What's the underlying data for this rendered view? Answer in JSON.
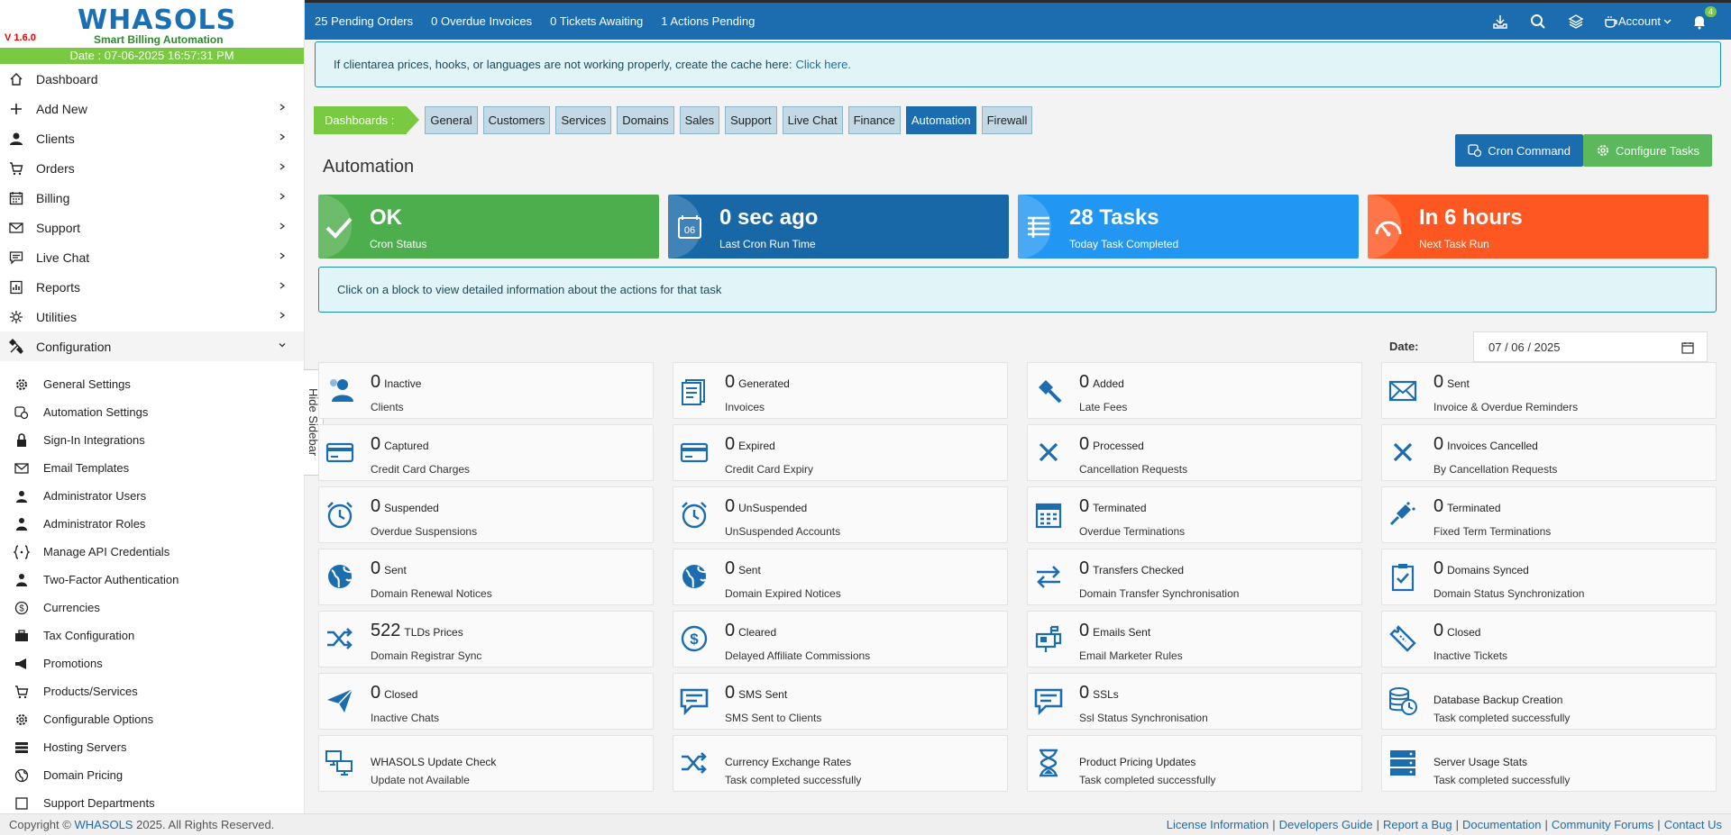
{
  "app": {
    "version": "V 1.6.0",
    "brand": "WHASOLS",
    "tagline": "Smart Billing Automation",
    "datetime": "Date : 07-06-2025 16:57:31 PM",
    "hide_sidebar": "Hide Sidebar"
  },
  "sidebar": {
    "items": [
      {
        "label": "Dashboard",
        "icon": "home-icon"
      },
      {
        "label": "Add New",
        "icon": "plus-icon"
      },
      {
        "label": "Clients",
        "icon": "user-icon"
      },
      {
        "label": "Orders",
        "icon": "cart-icon"
      },
      {
        "label": "Billing",
        "icon": "calendar-icon"
      },
      {
        "label": "Support",
        "icon": "envelope-icon"
      },
      {
        "label": "Live Chat",
        "icon": "chat-icon"
      },
      {
        "label": "Reports",
        "icon": "report-icon"
      },
      {
        "label": "Utilities",
        "icon": "utilities-icon"
      },
      {
        "label": "Configuration",
        "icon": "tools-icon"
      }
    ],
    "submenu": [
      "General Settings",
      "Automation Settings",
      "Sign-In Integrations",
      "Email Templates",
      "Administrator Users",
      "Administrator Roles",
      "Manage API Credentials",
      "Two-Factor Authentication",
      "Currencies",
      "Tax Configuration",
      "Promotions",
      "Products/Services",
      "Configurable Options",
      "Hosting Servers",
      "Domain Pricing",
      "Support Departments"
    ]
  },
  "topbar": {
    "pending_orders": "25 Pending Orders",
    "overdue_invoices": "0 Overdue Invoices",
    "tickets_awaiting": "0 Tickets Awaiting",
    "actions_pending": "1 Actions Pending",
    "account": "Account",
    "notification_count": "4"
  },
  "notice": {
    "text": "If clientarea prices, hooks, or languages are not working properly, create the cache here:",
    "link": "Click here."
  },
  "dashboards": {
    "label": "Dashboards :",
    "tabs": [
      "General",
      "Customers",
      "Services",
      "Domains",
      "Sales",
      "Support",
      "Live Chat",
      "Finance",
      "Automation",
      "Firewall"
    ],
    "active": "Automation"
  },
  "page": {
    "title": "Automation",
    "cron_command": "Cron Command",
    "configure_tasks": "Configure Tasks",
    "info": "Click on a block to view detailed information about the actions for that task",
    "date_label": "Date:",
    "date_value": "07 / 06 / 2025"
  },
  "stats": [
    {
      "value": "OK",
      "label": "Cron Status",
      "color": "#4cae4c"
    },
    {
      "value": "0 sec ago",
      "label": "Last Cron Run Time",
      "color": "#1868a8"
    },
    {
      "value": "28 Tasks",
      "label": "Today Task Completed",
      "color": "#2196f3"
    },
    {
      "value": "In 6 hours",
      "label": "Next Task Run",
      "color": "#fe5722"
    }
  ],
  "tasks": [
    {
      "num": "0",
      "unit": "Inactive",
      "sub": "Clients",
      "icon": "clients-icon"
    },
    {
      "num": "0",
      "unit": "Generated",
      "sub": "Invoices",
      "icon": "invoices-icon"
    },
    {
      "num": "0",
      "unit": "Added",
      "sub": "Late Fees",
      "icon": "gavel-icon"
    },
    {
      "num": "0",
      "unit": "Sent",
      "sub": "Invoice & Overdue Reminders",
      "icon": "envelope-icon"
    },
    {
      "num": "0",
      "unit": "Captured",
      "sub": "Credit Card Charges",
      "icon": "credit-card-icon"
    },
    {
      "num": "0",
      "unit": "Expired",
      "sub": "Credit Card Expiry",
      "icon": "credit-card-icon"
    },
    {
      "num": "0",
      "unit": "Processed",
      "sub": "Cancellation Requests",
      "icon": "close-icon"
    },
    {
      "num": "0",
      "unit": "Invoices Cancelled",
      "sub": "By Cancellation Requests",
      "icon": "close-icon"
    },
    {
      "num": "0",
      "unit": "Suspended",
      "sub": "Overdue Suspensions",
      "icon": "alarm-clock-icon"
    },
    {
      "num": "0",
      "unit": "UnSuspended",
      "sub": "UnSuspended Accounts",
      "icon": "alarm-clock-icon"
    },
    {
      "num": "0",
      "unit": "Terminated",
      "sub": "Overdue Terminations",
      "icon": "calendar-icon"
    },
    {
      "num": "0",
      "unit": "Terminated",
      "sub": "Fixed Term Terminations",
      "icon": "plug-icon"
    },
    {
      "num": "0",
      "unit": "Sent",
      "sub": "Domain Renewal Notices",
      "icon": "globe-icon"
    },
    {
      "num": "0",
      "unit": "Sent",
      "sub": "Domain Expired Notices",
      "icon": "globe-icon"
    },
    {
      "num": "0",
      "unit": "Transfers Checked",
      "sub": "Domain Transfer Synchronisation",
      "icon": "transfer-icon"
    },
    {
      "num": "0",
      "unit": "Domains Synced",
      "sub": "Domain Status Synchronization",
      "icon": "clipboard-check-icon"
    },
    {
      "num": "522",
      "unit": "TLDs Prices",
      "sub": "Domain Registrar Sync",
      "icon": "shuffle-icon"
    },
    {
      "num": "0",
      "unit": "Cleared",
      "sub": "Delayed Affiliate Commissions",
      "icon": "dollar-icon"
    },
    {
      "num": "0",
      "unit": "Emails Sent",
      "sub": "Email Marketer Rules",
      "icon": "mailbox-icon"
    },
    {
      "num": "0",
      "unit": "Closed",
      "sub": "Inactive Tickets",
      "icon": "ticket-icon"
    },
    {
      "num": "0",
      "unit": "Closed",
      "sub": "Inactive Chats",
      "icon": "paper-plane-icon"
    },
    {
      "num": "0",
      "unit": "SMS Sent",
      "sub": "SMS Sent to Clients",
      "icon": "message-icon"
    },
    {
      "num": "0",
      "unit": "SSLs",
      "sub": "Ssl Status Synchronisation",
      "icon": "message-icon"
    },
    {
      "num": "",
      "unit": "",
      "title": "Database Backup Creation",
      "sub": "Task completed successfully",
      "icon": "database-clock-icon"
    },
    {
      "num": "",
      "unit": "",
      "title": "WHASOLS Update Check",
      "sub": "Update not Available",
      "icon": "computers-icon"
    },
    {
      "num": "",
      "unit": "",
      "title": "Currency Exchange Rates",
      "sub": "Task completed successfully",
      "icon": "shuffle-icon"
    },
    {
      "num": "",
      "unit": "",
      "title": "Product Pricing Updates",
      "sub": "Task completed successfully",
      "icon": "hourglass-icon"
    },
    {
      "num": "",
      "unit": "",
      "title": "Server Usage Stats",
      "sub": "Task completed successfully",
      "icon": "server-icon"
    }
  ],
  "footer": {
    "copyright_prefix": "Copyright ©",
    "brand": "WHASOLS",
    "copyright_suffix": "2025. All Rights Reserved.",
    "links": [
      "License Information",
      "Developers Guide",
      "Report a Bug",
      "Documentation",
      "Community Forums",
      "Contact Us"
    ]
  }
}
